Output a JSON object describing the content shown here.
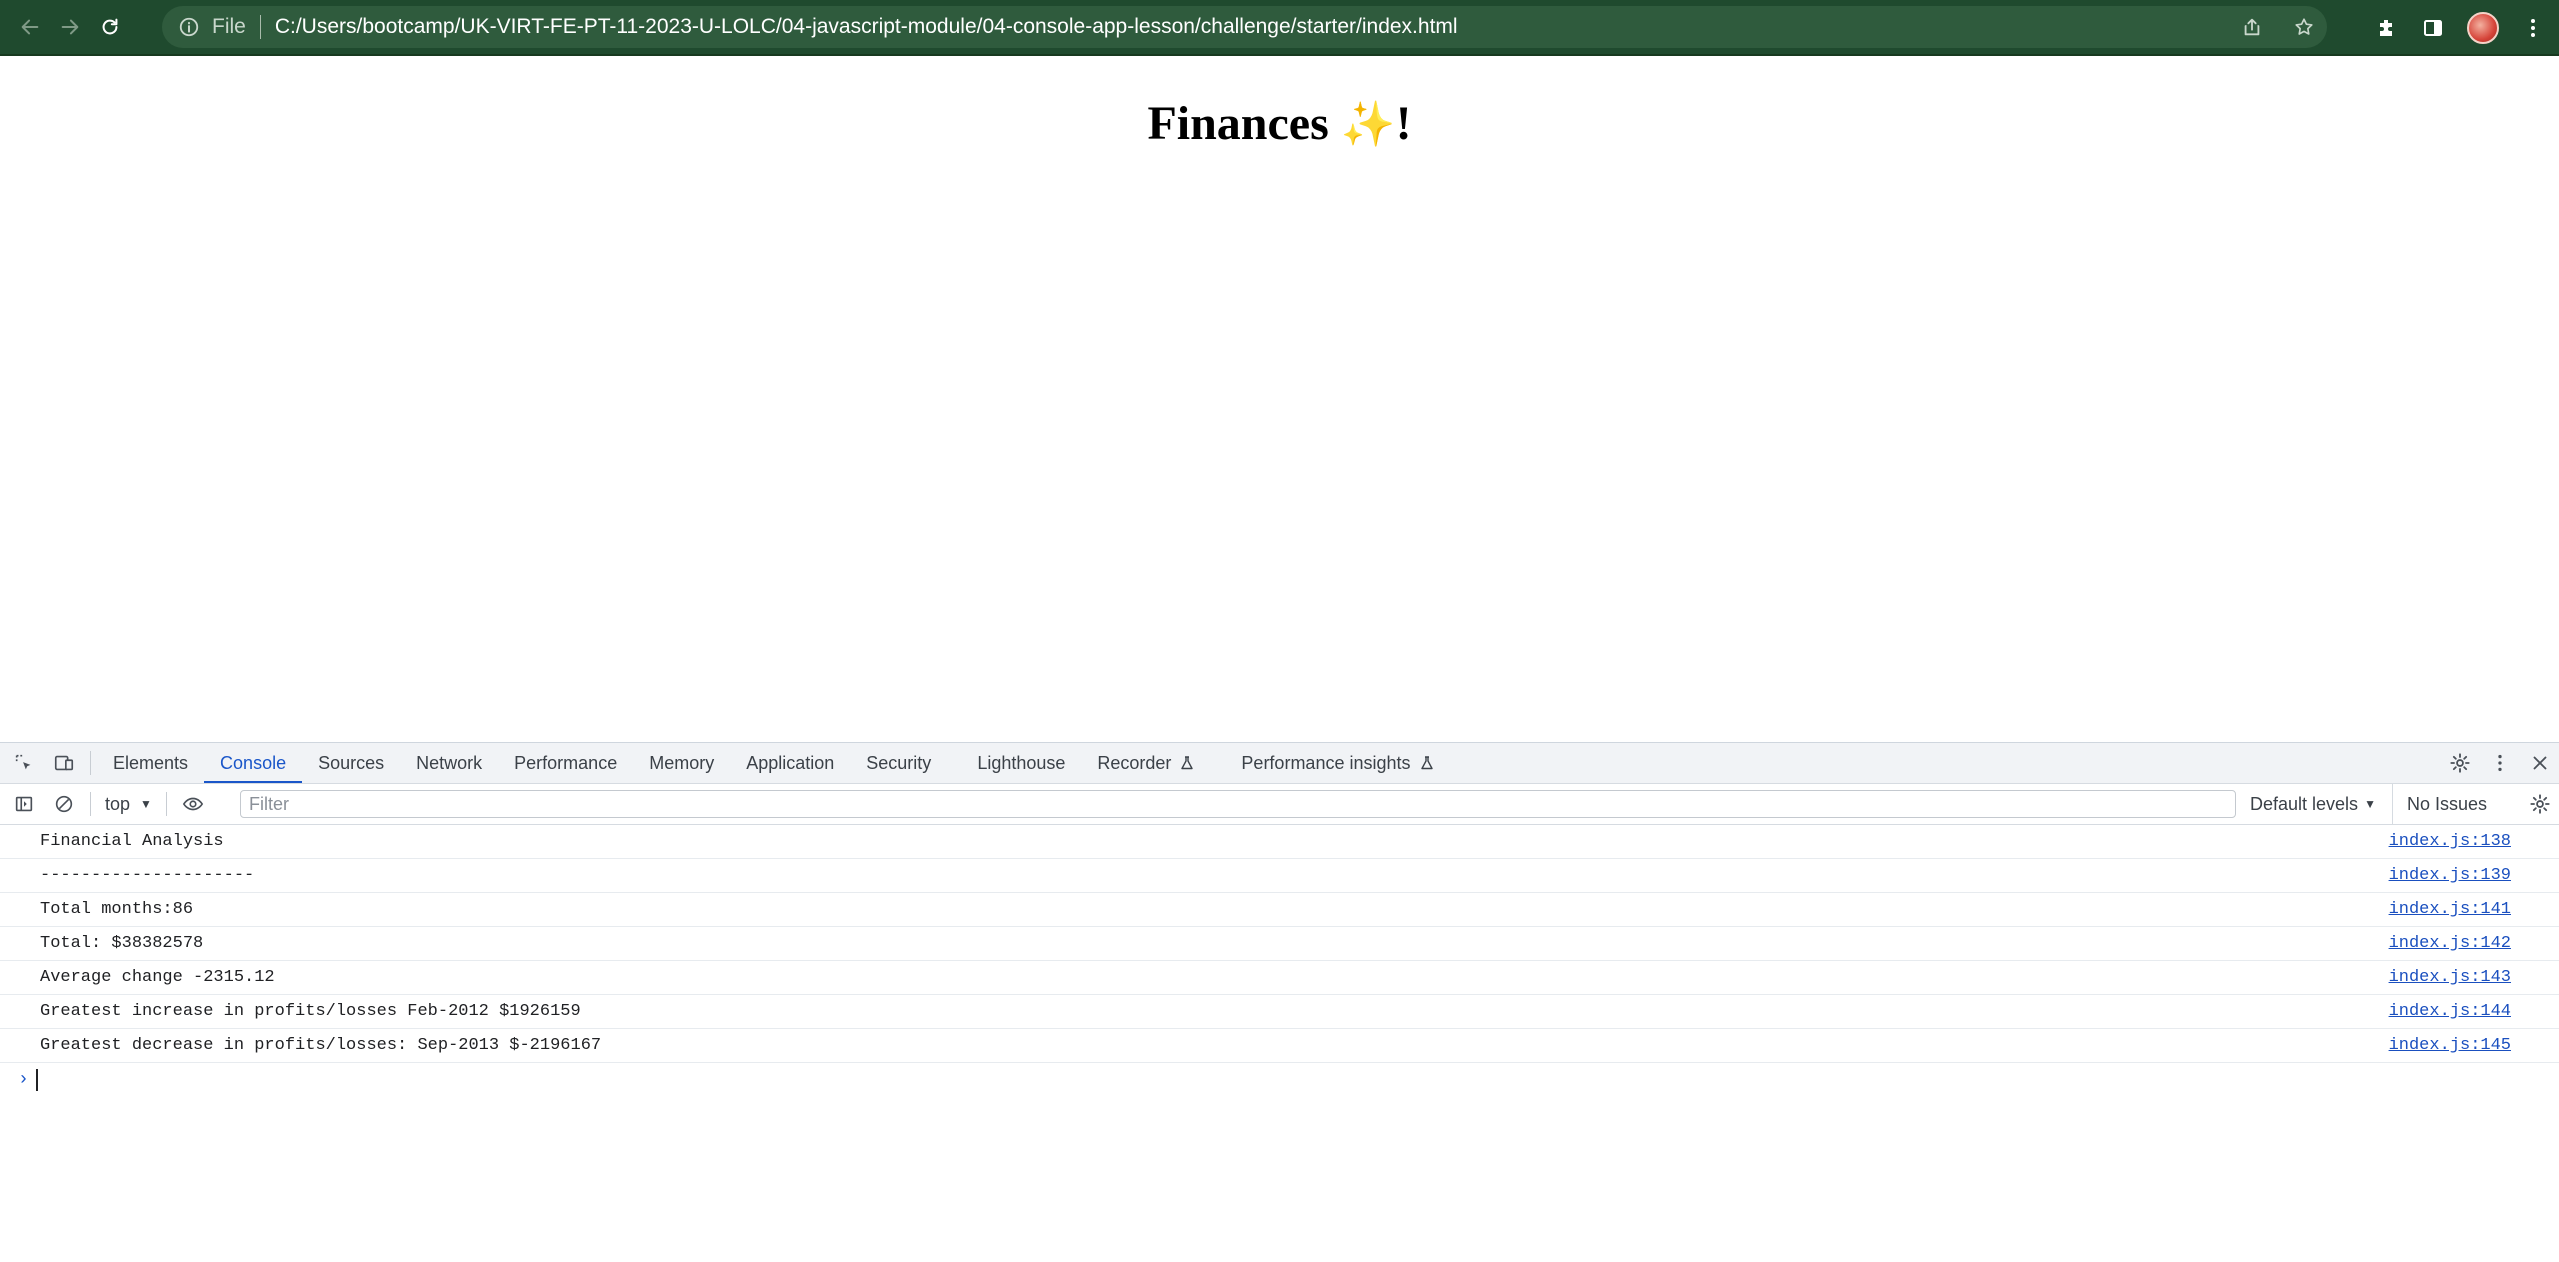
{
  "browser": {
    "scheme_label": "File",
    "url": "C:/Users/bootcamp/UK-VIRT-FE-PT-11-2023-U-LOLC/04-javascript-module/04-console-app-lesson/challenge/starter/index.html",
    "icons": [
      "back-arrow-icon",
      "forward-arrow-icon",
      "reload-icon",
      "info-icon",
      "share-icon",
      "star-icon",
      "extensions-icon",
      "side-panel-icon",
      "avatar",
      "kebab-menu-icon"
    ],
    "colors": {
      "toolbar_bg": "#1f4a2e",
      "omnibox_bg": "#2f5b3d"
    }
  },
  "page": {
    "title_text": "Finances",
    "title_emoji": "✨",
    "title_suffix": "!"
  },
  "devtools": {
    "tabs": [
      {
        "label": "Elements",
        "active": false
      },
      {
        "label": "Console",
        "active": true
      },
      {
        "label": "Sources",
        "active": false
      },
      {
        "label": "Network",
        "active": false
      },
      {
        "label": "Performance",
        "active": false
      },
      {
        "label": "Memory",
        "active": false
      },
      {
        "label": "Application",
        "active": false
      },
      {
        "label": "Security",
        "active": false
      },
      {
        "label": "Lighthouse",
        "active": false
      },
      {
        "label": "Recorder",
        "active": false
      },
      {
        "label": "Performance insights",
        "active": false
      }
    ],
    "console_toolbar": {
      "context": "top",
      "filter_placeholder": "Filter",
      "levels": "Default levels",
      "issues": "No Issues"
    },
    "logs": [
      {
        "message": "Financial Analysis",
        "source": "index.js:138"
      },
      {
        "message": "---------------------",
        "source": "index.js:139"
      },
      {
        "message": "Total months:86",
        "source": "index.js:141"
      },
      {
        "message": "Total: $38382578",
        "source": "index.js:142"
      },
      {
        "message": "Average change -2315.12",
        "source": "index.js:143"
      },
      {
        "message": "Greatest increase in profits/losses Feb-2012 $1926159",
        "source": "index.js:144"
      },
      {
        "message": "Greatest decrease in profits/losses: Sep-2013 $-2196167",
        "source": "index.js:145"
      }
    ],
    "prompt_symbol": "›"
  }
}
